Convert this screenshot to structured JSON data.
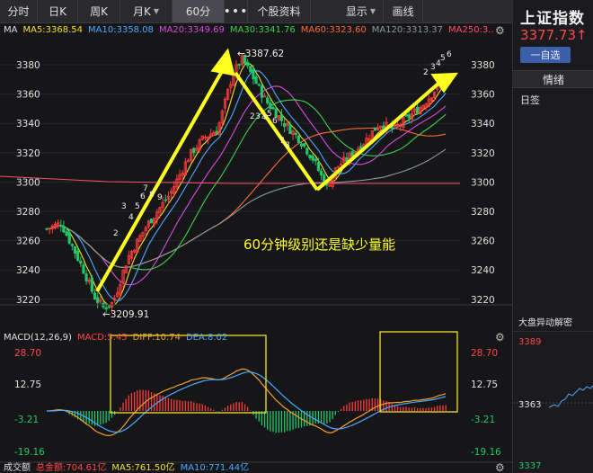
{
  "tabs": [
    {
      "label": "分时",
      "active": false
    },
    {
      "label": "日K",
      "active": false
    },
    {
      "label": "周K",
      "active": false
    },
    {
      "label": "月K",
      "active": false,
      "caret": true
    },
    {
      "label": "60分",
      "active": true
    },
    {
      "label": "•••",
      "active": false
    },
    {
      "label": "个股资料",
      "active": false
    },
    {
      "label": "显示",
      "active": false,
      "caret": true
    },
    {
      "label": "画线",
      "active": false
    }
  ],
  "ma_legend": {
    "label": "MA",
    "items": [
      {
        "text": "MA5:3368.54",
        "color": "#f0e030"
      },
      {
        "text": "MA10:3358.08",
        "color": "#4aa8ff"
      },
      {
        "text": "MA20:3349.69",
        "color": "#d84adf"
      },
      {
        "text": "MA30:3341.76",
        "color": "#3cd24a"
      },
      {
        "text": "MA60:3323.60",
        "color": "#ff6a3a"
      },
      {
        "text": "MA120:3313.37",
        "color": "#8a9a9a"
      },
      {
        "text": "MA250:3...",
        "color": "#ff4f6a"
      }
    ]
  },
  "price_axis": {
    "ticks": [
      "3380",
      "3360",
      "3340",
      "3320",
      "3300",
      "3280",
      "3260",
      "3240",
      "3220"
    ]
  },
  "annotations": {
    "high_label": "←3387.62",
    "low_label": "←3209.91",
    "overlay_text": "60分钟级别还是缺少量能"
  },
  "td_counts_up": [
    "2",
    "3",
    "4",
    "5",
    "6",
    "7",
    "8",
    "9"
  ],
  "td_counts_down": [
    "2",
    "3",
    "4",
    "5",
    "6",
    "7",
    "8"
  ],
  "td_counts_right": [
    "2",
    "3",
    "4",
    "5",
    "6"
  ],
  "macd_legend": {
    "label": "MACD(12,26,9)",
    "items": [
      {
        "text": "MACD:5.45",
        "color": "#ff4848"
      },
      {
        "text": "DIFF:10.74",
        "color": "#f0a030"
      },
      {
        "text": "DEA:8.02",
        "color": "#4aa8ff"
      }
    ]
  },
  "macd_axis": {
    "ticks": [
      "28.70",
      "12.75",
      "-3.21",
      "-19.16"
    ]
  },
  "volume_legend": {
    "label": "成交额",
    "items": [
      {
        "text": "总金额:704.61亿",
        "color": "#ff4848"
      },
      {
        "text": "MA5:761.50亿",
        "color": "#f0e030"
      },
      {
        "text": "MA10:771.44亿",
        "color": "#4aa8ff"
      }
    ]
  },
  "right_panel": {
    "index_name": "上证指数",
    "price": "3377.73↑",
    "watch_button": "一自选",
    "tab_label": "情绪",
    "tag_label": "日签",
    "anomaly_title": "大盘异动解密",
    "mini_ticks": [
      "3389",
      "3363",
      "3337"
    ]
  },
  "colors": {
    "up": "#ff3b3b",
    "down": "#1fc86a",
    "arrow": "#ffff20",
    "box": "#f0e030"
  }
}
